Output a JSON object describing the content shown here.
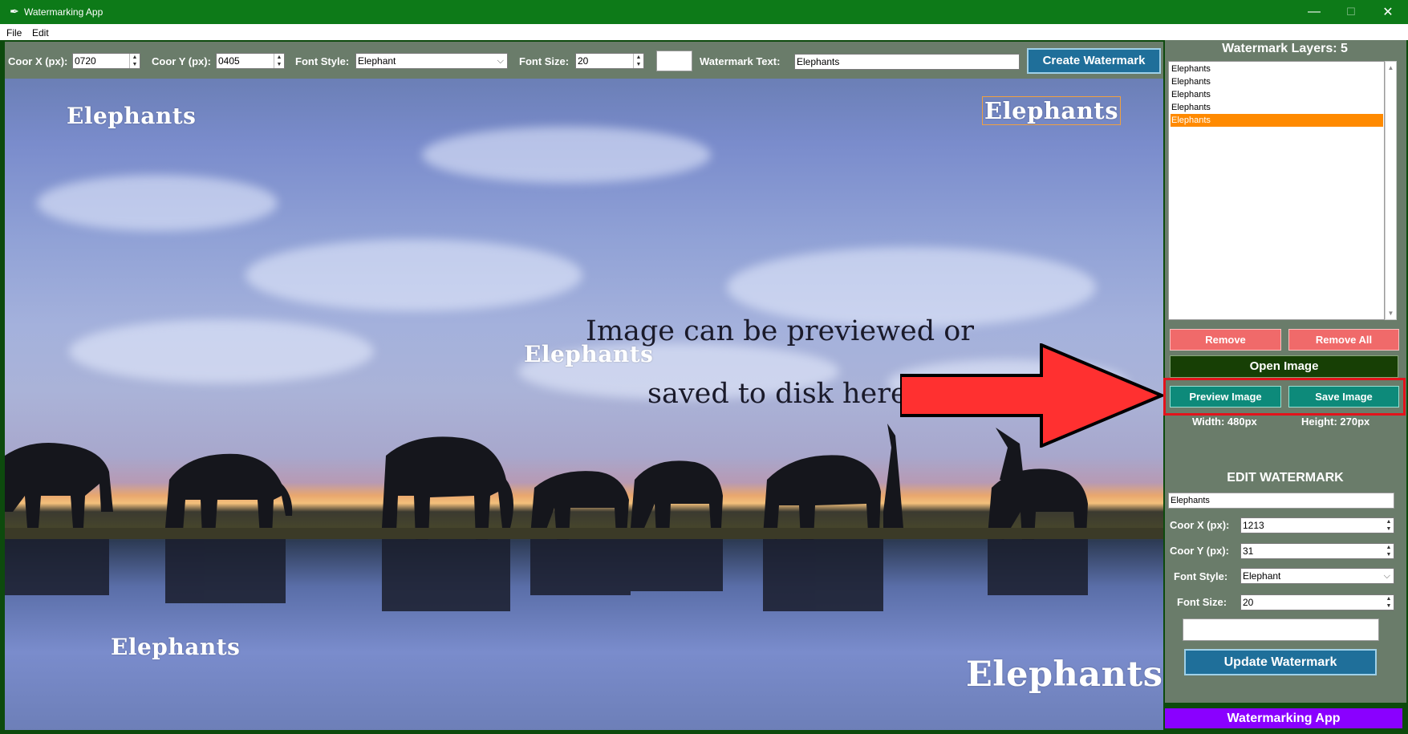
{
  "window": {
    "title": "Watermarking App",
    "minimize_glyph": "—",
    "maximize_glyph": "☐",
    "close_glyph": "✕"
  },
  "menu": {
    "items": [
      "File",
      "Edit"
    ]
  },
  "toolbar": {
    "coor_x_label": "Coor X (px):",
    "coor_x_value": "0720",
    "coor_y_label": "Coor Y (px):",
    "coor_y_value": "0405",
    "font_style_label": "Font Style:",
    "font_style_value": "Elephant",
    "font_size_label": "Font Size:",
    "font_size_value": "20",
    "watermark_text_label": "Watermark Text:",
    "watermark_text_value": "Elephants",
    "create_button": "Create Watermark"
  },
  "canvas": {
    "watermarks": [
      "Elephants",
      "Elephants",
      "Elephants",
      "Elephants",
      "Elephants"
    ],
    "annotation_line1": "Image can be previewed or",
    "annotation_line2": "saved to disk here",
    "arrow_color": "#ff3030"
  },
  "layers": {
    "title": "Watermark Layers: 5",
    "items": [
      "Elephants",
      "Elephants",
      "Elephants",
      "Elephants",
      "Elephants"
    ],
    "selected_index": 4
  },
  "actions": {
    "remove": "Remove",
    "remove_all": "Remove All",
    "open_image": "Open Image",
    "preview_image": "Preview Image",
    "save_image": "Save Image",
    "width": "Width: 480px",
    "height": "Height: 270px"
  },
  "edit": {
    "title": "EDIT WATERMARK",
    "text_value": "Elephants",
    "coor_x_label": "Coor X (px):",
    "coor_x_value": "1213",
    "coor_y_label": "Coor Y (px):",
    "coor_y_value": "31",
    "font_style_label": "Font Style:",
    "font_style_value": "Elephant",
    "font_size_label": "Font Size:",
    "font_size_value": "20",
    "update_button": "Update Watermark"
  },
  "footer": "Watermarking App",
  "colors": {
    "title_bar": "#0d7a18",
    "panel_bg": "#6a7c6a",
    "accent_button": "#1f6f9a",
    "remove_button": "#f06a6a",
    "teal_button": "#0d8a7a",
    "selection": "#ff8a00",
    "footer": "#8a00ff",
    "highlight_frame": "#e3131b"
  }
}
